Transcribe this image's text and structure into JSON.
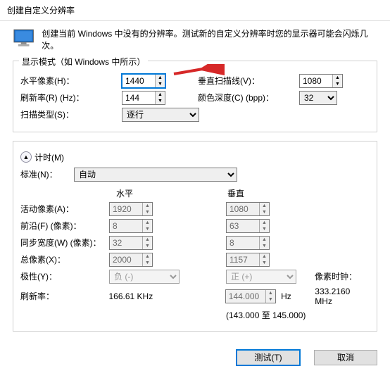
{
  "title": "创建自定义分辨率",
  "intro": "创建当前 Windows 中没有的分辨率。测试新的自定义分辨率时您的显示器可能会闪烁几次。",
  "display_mode": {
    "legend": "显示模式（如 Windows 中所示）",
    "h_pixels_label": "水平像素(H)：",
    "h_pixels_value": "1440",
    "v_scanlines_label": "垂直扫描线(V)：",
    "v_scanlines_value": "1080",
    "refresh_label": "刷新率(R) (Hz)：",
    "refresh_value": "144",
    "color_label": "颜色深度(C) (bpp)：",
    "color_value": "32",
    "scan_label": "扫描类型(S)：",
    "scan_value": "逐行"
  },
  "timing": {
    "legend": "计时(M)",
    "standard_label": "标准(N)：",
    "standard_value": "自动",
    "col_h": "水平",
    "col_v": "垂直",
    "active_label": "活动像素(A)：",
    "active_h": "1920",
    "active_v": "1080",
    "front_label": "前沿(F) (像素)：",
    "front_h": "8",
    "front_v": "63",
    "sync_label": "同步宽度(W) (像素)：",
    "sync_h": "32",
    "sync_v": "8",
    "total_label": "总像素(X)：",
    "total_h": "2000",
    "total_v": "1157",
    "polarity_label": "极性(Y)：",
    "polarity_h": "负 (-)",
    "polarity_v": "正 (+)",
    "pixel_clock_label": "像素时钟：",
    "pixel_clock_value": "333.2160 MHz",
    "refresh_rate_label": "刷新率：",
    "refresh_rate_h": "166.61 KHz",
    "refresh_rate_v": "144.000",
    "refresh_rate_v_unit": "Hz",
    "range_hint": "(143.000 至 145.000)"
  },
  "buttons": {
    "test": "测试(T)",
    "cancel": "取消"
  }
}
